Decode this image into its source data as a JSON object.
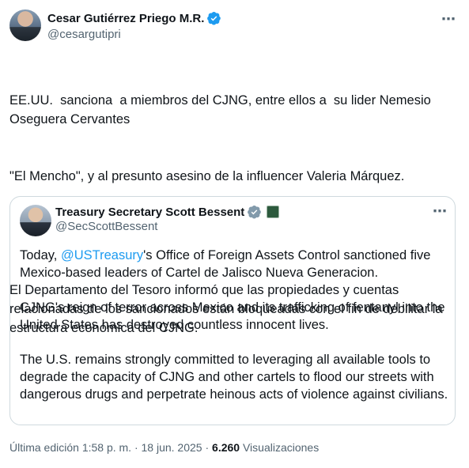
{
  "author": {
    "name": "Cesar Gutiérrez Priego M.R.",
    "handle": "@cesargutipri"
  },
  "more_icon": "⋯",
  "tweet": {
    "paragraph1_line1": "EE.UU.  sanciona  a miembros del CJNG, entre ellos a  su lider Nemesio Oseguera Cervantes",
    "paragraph1_line2": "\"El Mencho\", y al presunto asesino de la influencer Valeria Márquez.",
    "paragraph2": "El Departamento del Tesoro informó que las propiedades y cuentas relacionadas de los sancionados están bloqueadas con el fin de debilitar la estructura económica del CJNG."
  },
  "quoted": {
    "name": "Treasury Secretary Scott Bessent",
    "handle": "@SecScottBessent",
    "p1_prefix": "Today, ",
    "p1_link": "@USTreasury",
    "p1_suffix": "'s Office of Foreign Assets Control sanctioned five Mexico-based leaders of Cartel de Jalisco Nueva Generacion.",
    "p2": "CJNG's reign of terror across Mexico and its trafficking of fentanyl into the United States has destroyed countless innocent lives.",
    "p3": "The U.S. remains strongly committed to leveraging all available tools to degrade the capacity of CJNG and other cartels to flood our streets with dangerous drugs and perpetrate heinous acts of violence against civilians."
  },
  "footer": {
    "edited": "Última edición 1:58 p. m. · 18 jun. 2025 · ",
    "views_count": "6.260",
    "views_label": " Visualizaciones"
  },
  "colors": {
    "verified": "#1d9bf0",
    "link": "#1d9bf0",
    "secondary_text": "#536471"
  }
}
